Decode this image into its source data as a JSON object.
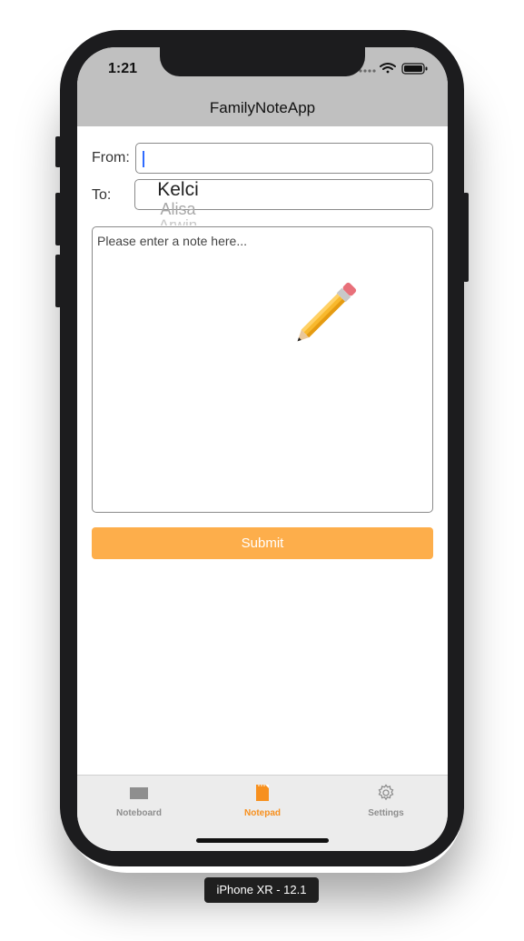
{
  "status_bar": {
    "time": "1:21"
  },
  "nav": {
    "title": "FamilyNoteApp"
  },
  "form": {
    "from_label": "From:",
    "from_value": "",
    "to_label": "To:",
    "to_picker": {
      "selected": "Kelci",
      "options": [
        "Kelci",
        "Alisa",
        "Arwin"
      ]
    },
    "note_placeholder": "Please enter a note here...",
    "submit_label": "Submit"
  },
  "tabs": [
    {
      "label": "Noteboard",
      "icon": "noteboard-icon",
      "active": false
    },
    {
      "label": "Notepad",
      "icon": "notepad-icon",
      "active": true
    },
    {
      "label": "Settings",
      "icon": "gear-icon",
      "active": false
    }
  ],
  "device_label": "iPhone XR - 12.1",
  "colors": {
    "accent": "#f7901e",
    "submit_bg": "#fdae4b",
    "nav_bg": "#c0c0c0"
  }
}
